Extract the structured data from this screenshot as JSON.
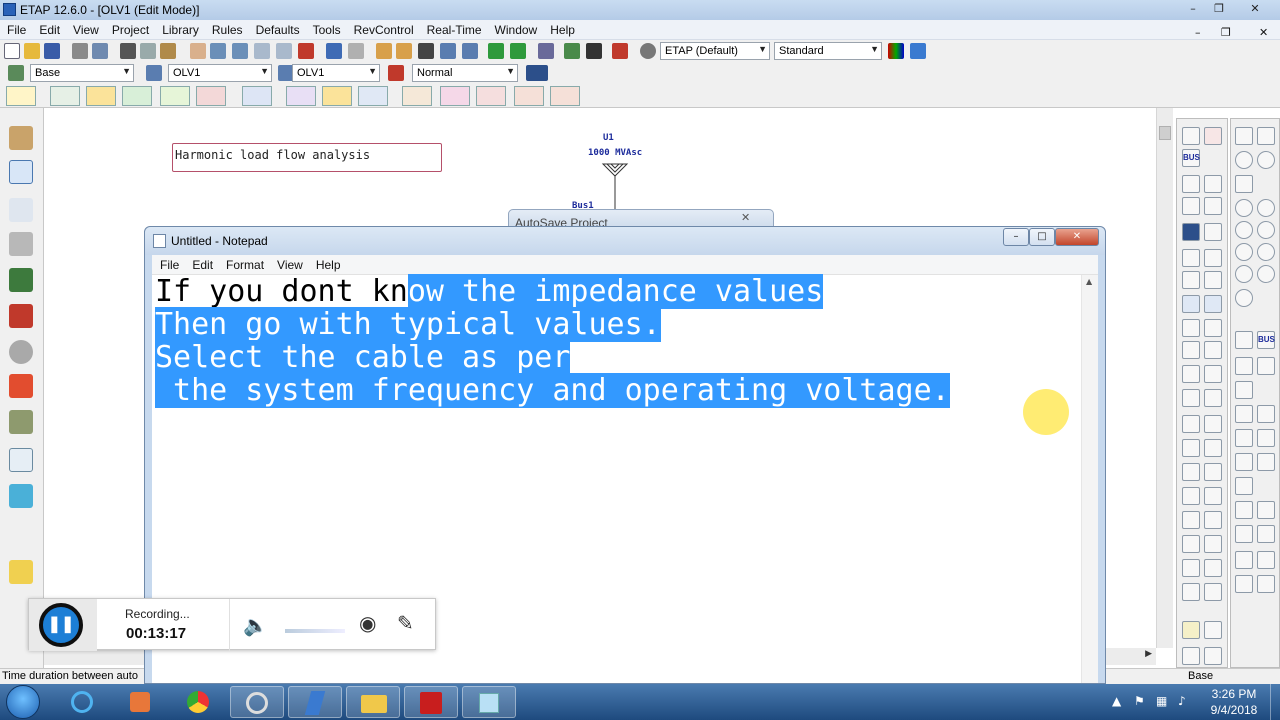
{
  "etap": {
    "title": "ETAP 12.6.0 - [OLV1 (Edit Mode)]",
    "menu": [
      "File",
      "Edit",
      "View",
      "Project",
      "Library",
      "Rules",
      "Defaults",
      "Tools",
      "RevControl",
      "Real-Time",
      "Window",
      "Help"
    ],
    "toolbar": {
      "base_combo": "Base",
      "olv_combo_1": "OLV1",
      "olv_combo_2": "OLV1",
      "normal_combo": "Normal",
      "etap_default_combo": "ETAP (Default)",
      "standard_combo": "Standard"
    },
    "diagram": {
      "label_box": "Harmonic load flow analysis",
      "utility_name": "U1",
      "utility_rating": "1000 MVAsc",
      "bus_name": "Bus1"
    },
    "autosave_title": "AutoSave Project",
    "status_left": "Time duration between auto",
    "status_right": "Base",
    "right_palette_label_1": "BUS",
    "right_palette_label_2": "BUS"
  },
  "notepad": {
    "title": "Untitled - Notepad",
    "menu": [
      "File",
      "Edit",
      "Format",
      "View",
      "Help"
    ],
    "text": {
      "line1_unselected": "If you dont kn",
      "line1_selected": "ow the impedance values",
      "line2": "Then go with typical values.",
      "line3": "Select the cable as per",
      "line4": " the system frequency and operating voltage."
    }
  },
  "recorder": {
    "state": "Recording...",
    "elapsed": "00:13:17"
  },
  "taskbar": {
    "time": "3:26 PM",
    "date": "9/4/2018"
  },
  "colors": {
    "selection": "#3399ff",
    "recorder_button": "#1d7fd6",
    "cursor_highlight": "#ffe95a",
    "diagram_text": "#1c2b9b"
  }
}
